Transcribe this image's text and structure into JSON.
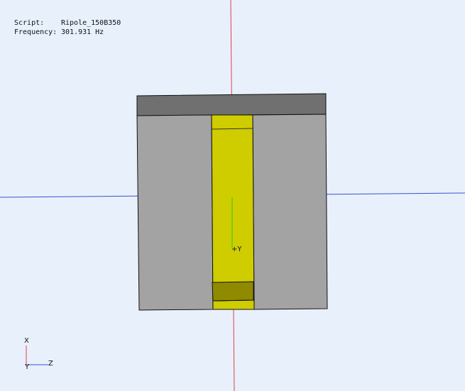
{
  "overlay": {
    "script_label": "Script:",
    "script_value": "Ripole_150B350",
    "frequency_label": "Frequency:",
    "frequency_value": "301.931 Hz"
  },
  "model_label": "+Y",
  "triad": {
    "x_label": "X",
    "y_label": "Y",
    "z_label": "Z"
  },
  "colors": {
    "background": "#e8f1fb",
    "axis_vertical": "#e0404a",
    "axis_horizontal": "#3a4fd0",
    "cabinet_top": "#707070",
    "cabinet_side": "#a3a3a3",
    "driver_yellow": "#cfcc00",
    "driver_dark": "#8f8a00",
    "green_axis": "#22cc22"
  }
}
